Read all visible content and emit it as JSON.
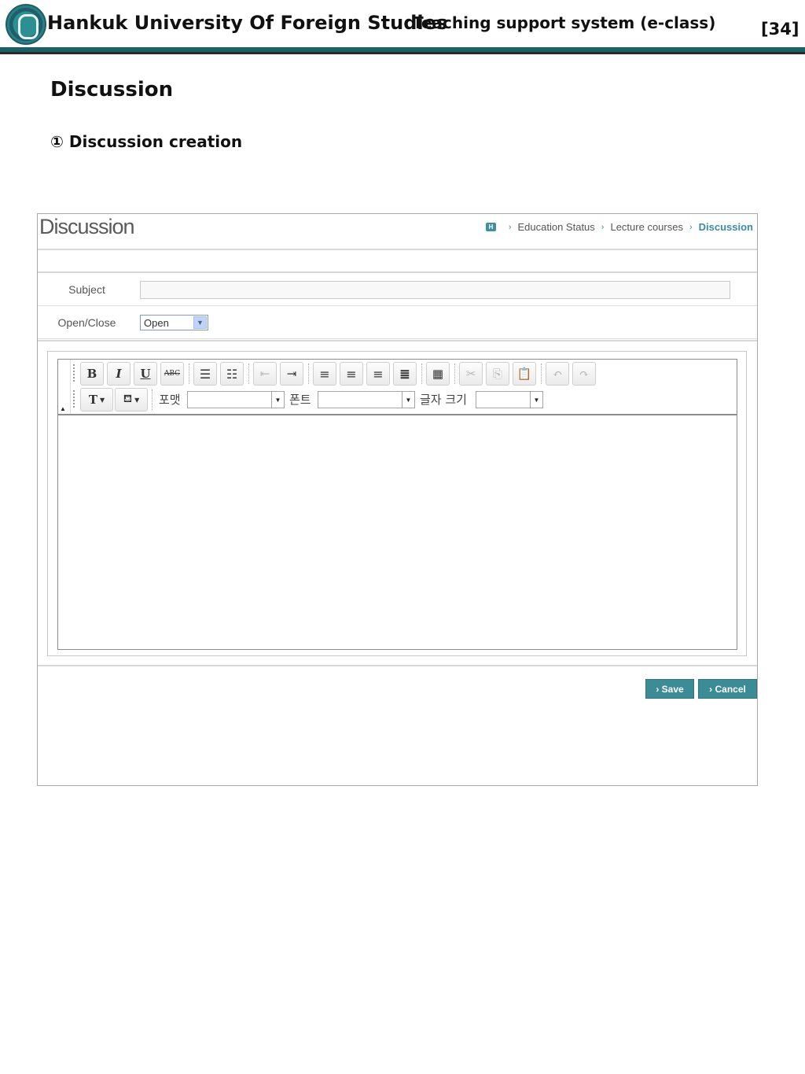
{
  "header": {
    "university": "Hankuk University Of Foreign Studies",
    "system": "Teaching support system (e-class)",
    "page_number": "[34]"
  },
  "slide": {
    "title": "Discussion",
    "subtitle": "① Discussion creation"
  },
  "screen": {
    "title": "Discussion",
    "breadcrumb": {
      "home_icon": "H",
      "items": [
        "Education Status",
        "Lecture courses"
      ],
      "current": "Discussion"
    },
    "form": {
      "subject_label": "Subject",
      "subject_value": "",
      "open_close_label": "Open/Close",
      "open_close_value": "Open"
    },
    "editor": {
      "buttons": {
        "bold": "B",
        "italic": "I",
        "underline": "U",
        "strike": "ABC",
        "text_color": "T"
      },
      "format_label": "포맷",
      "font_label": "폰트",
      "size_label": "글자 크기",
      "format_value": "",
      "font_value": "",
      "size_value": ""
    },
    "actions": {
      "save": "› Save",
      "cancel": "› Cancel"
    }
  },
  "colors": {
    "brand_teal": "#1c5f66",
    "button_teal": "#3b8c97",
    "breadcrumb_current": "#3a8ba7"
  }
}
